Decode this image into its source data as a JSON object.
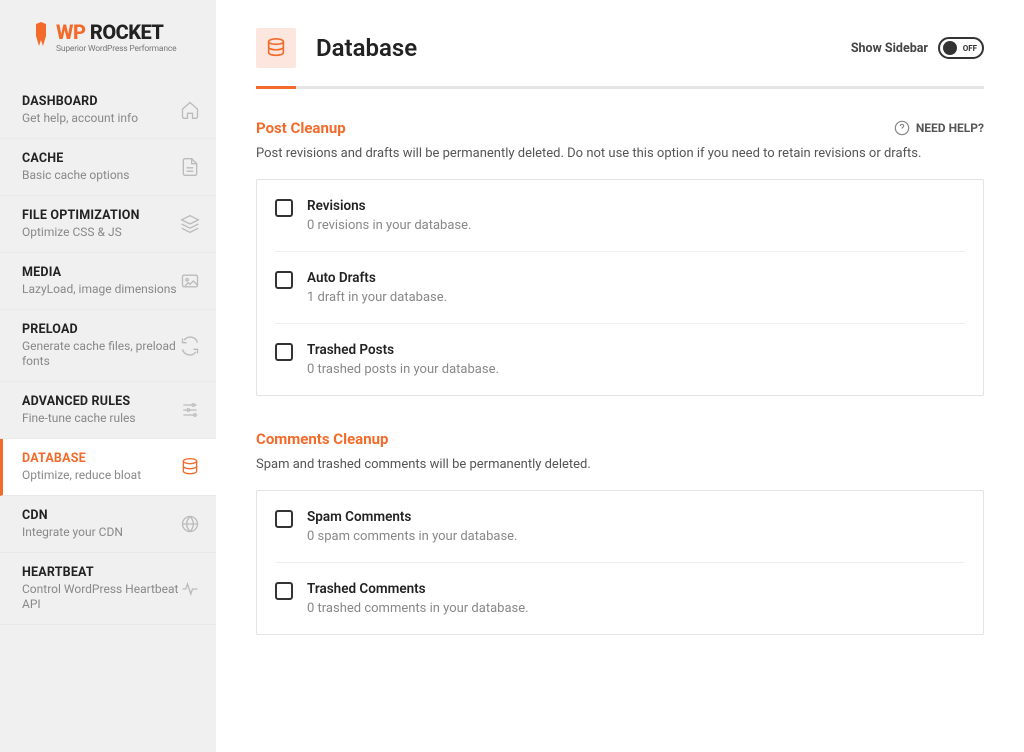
{
  "logo": {
    "brand_a": "WP",
    "brand_b": " ROCKET",
    "tagline": "Superior WordPress Performance"
  },
  "nav": [
    {
      "title": "DASHBOARD",
      "desc": "Get help, account info",
      "icon": "home"
    },
    {
      "title": "CACHE",
      "desc": "Basic cache options",
      "icon": "file"
    },
    {
      "title": "FILE OPTIMIZATION",
      "desc": "Optimize CSS & JS",
      "icon": "layers"
    },
    {
      "title": "MEDIA",
      "desc": "LazyLoad, image dimensions",
      "icon": "image"
    },
    {
      "title": "PRELOAD",
      "desc": "Generate cache files, preload fonts",
      "icon": "refresh"
    },
    {
      "title": "ADVANCED RULES",
      "desc": "Fine-tune cache rules",
      "icon": "sliders"
    },
    {
      "title": "DATABASE",
      "desc": "Optimize, reduce bloat",
      "icon": "database",
      "active": true
    },
    {
      "title": "CDN",
      "desc": "Integrate your CDN",
      "icon": "globe"
    },
    {
      "title": "HEARTBEAT",
      "desc": "Control WordPress Heartbeat API",
      "icon": "heartbeat"
    }
  ],
  "header": {
    "title": "Database",
    "toggle_label": "Show Sidebar",
    "toggle_state": "OFF"
  },
  "help_link": "NEED HELP?",
  "sections": [
    {
      "title": "Post Cleanup",
      "desc": "Post revisions and drafts will be permanently deleted. Do not use this option if you need to retain revisions or drafts.",
      "options": [
        {
          "title": "Revisions",
          "desc": "0 revisions in your database."
        },
        {
          "title": "Auto Drafts",
          "desc": "1 draft in your database."
        },
        {
          "title": "Trashed Posts",
          "desc": "0 trashed posts in your database."
        }
      ]
    },
    {
      "title": "Comments Cleanup",
      "desc": "Spam and trashed comments will be permanently deleted.",
      "options": [
        {
          "title": "Spam Comments",
          "desc": "0 spam comments in your database."
        },
        {
          "title": "Trashed Comments",
          "desc": "0 trashed comments in your database."
        }
      ]
    }
  ]
}
